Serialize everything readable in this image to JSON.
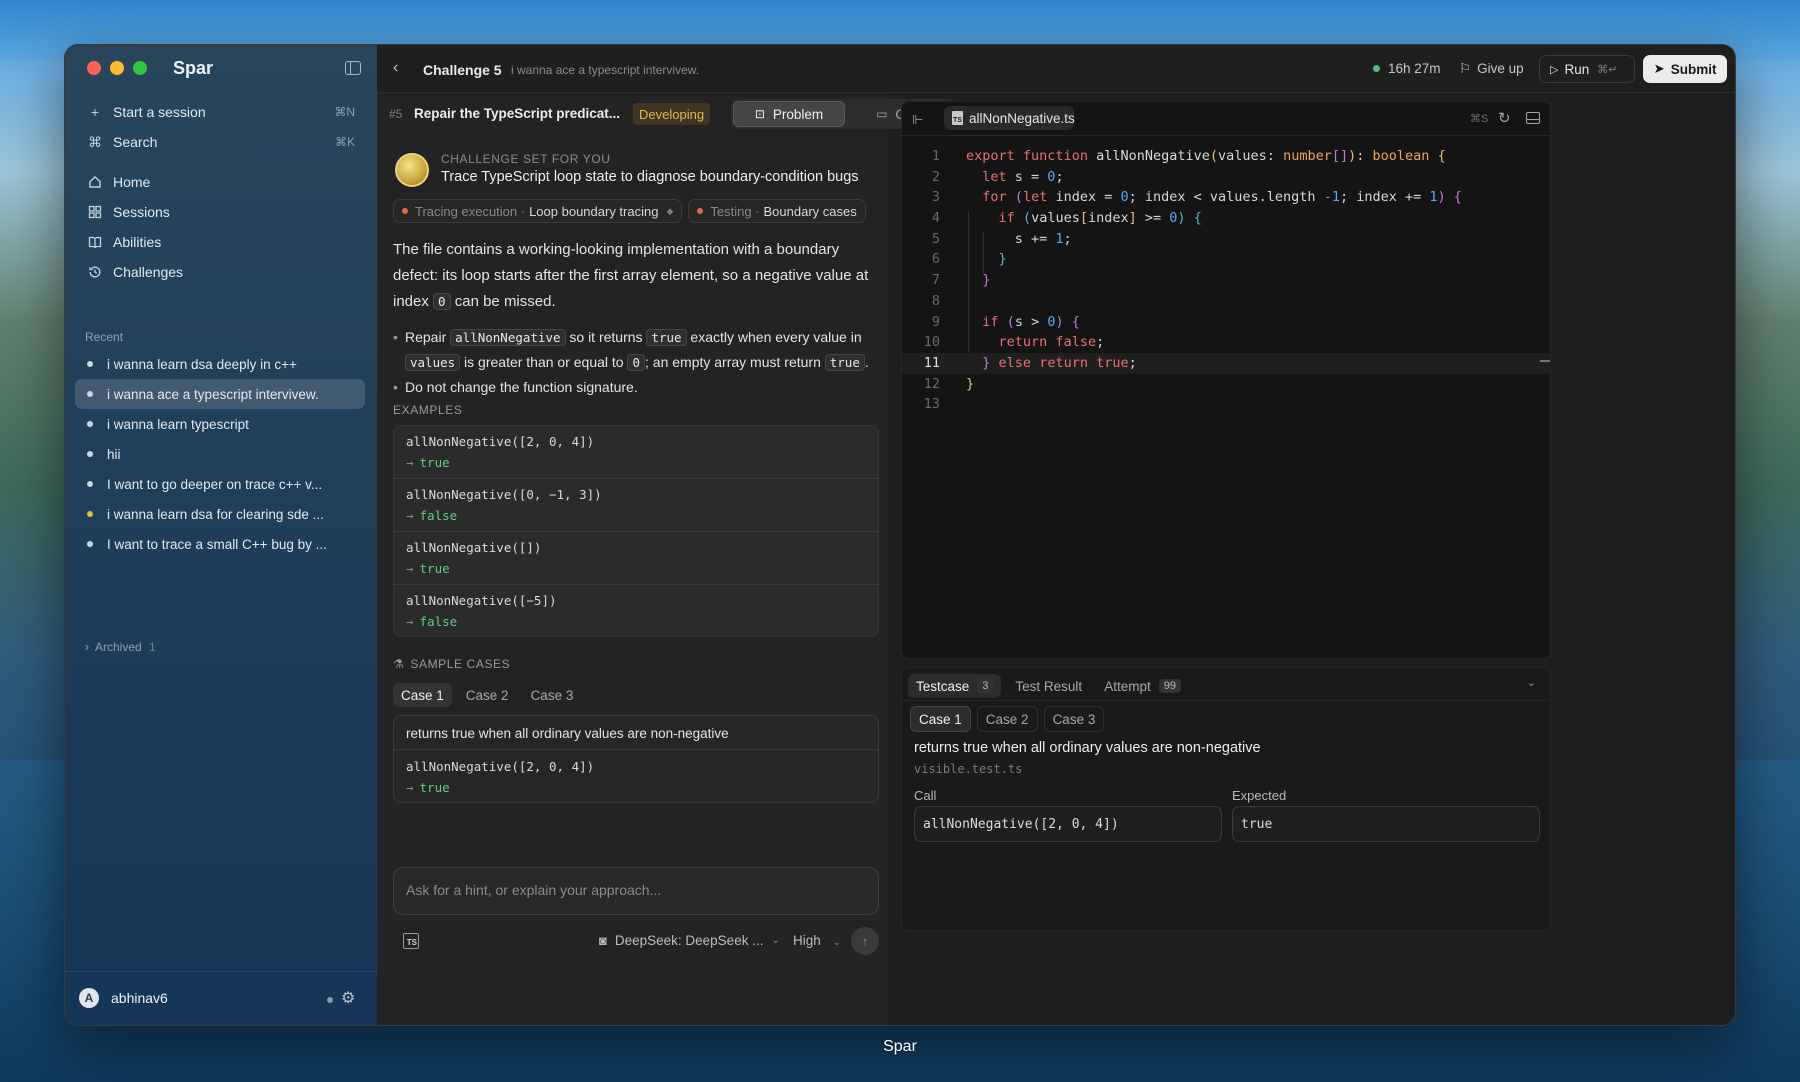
{
  "app": {
    "name": "Spar"
  },
  "sidebar": {
    "nav_top": [
      {
        "label": "Start a session",
        "shortcut": "⌘N",
        "icon": "plus-icon"
      },
      {
        "label": "Search",
        "shortcut": "⌘K",
        "icon": "command-icon"
      }
    ],
    "nav": [
      {
        "label": "Home",
        "icon": "home-icon"
      },
      {
        "label": "Sessions",
        "icon": "grid-icon"
      },
      {
        "label": "Abilities",
        "icon": "book-icon"
      },
      {
        "label": "Challenges",
        "icon": "history-icon"
      }
    ],
    "recent_label": "Recent",
    "recent": [
      {
        "label": "i wanna learn dsa deeply in c++",
        "dot": "#cfd8df"
      },
      {
        "label": "i wanna ace a typescript intervivew.",
        "dot": "#cfd8df",
        "active": true
      },
      {
        "label": "i wanna learn typescript",
        "dot": "#cfd8df"
      },
      {
        "label": "hii",
        "dot": "#cfd8df"
      },
      {
        "label": "I want to go deeper on trace c++ v...",
        "dot": "#cfd8df"
      },
      {
        "label": "i wanna learn dsa for clearing sde ...",
        "dot": "#e8b84a"
      },
      {
        "label": "I want to trace a small C++ bug by ...",
        "dot": "#cfd8df"
      }
    ],
    "archived": {
      "label": "Archived",
      "count": "1"
    },
    "user": {
      "initial": "A",
      "name": "abhinav6"
    }
  },
  "topbar": {
    "title": "Challenge 5",
    "subtitle": "i wanna ace a typescript intervivew.",
    "timer": "16h 27m",
    "give_up": "Give up",
    "run": "Run",
    "run_kbd": "⌘↵",
    "submit": "Submit"
  },
  "problem": {
    "number": "#5",
    "title": "Repair the TypeScript predicat...",
    "status": "Developing",
    "tabs": [
      "Problem",
      "Chat"
    ],
    "kicker": "CHALLENGE SET FOR YOU",
    "challenge_title": "Trace TypeScript loop state to diagnose boundary-condition bugs",
    "chips": [
      {
        "category": "Tracing execution ·",
        "label": "Loop boundary tracing"
      },
      {
        "category": "Testing ·",
        "label": "Boundary cases"
      }
    ],
    "description_a": "The file contains a working-looking implementation with a boundary defect: its loop starts after the first array element, so a negative value at index",
    "description_code": "0",
    "description_b": "can be missed.",
    "bullet1": {
      "a": "Repair",
      "c1": "allNonNegative",
      "b": "so it returns",
      "c2": "true",
      "c": "exactly when every value in",
      "c3": "values",
      "d": "is greater than or equal to",
      "c4": "0",
      "e": "; an empty array must return",
      "c5": "true",
      "f": "."
    },
    "bullet2": "Do not change the function signature.",
    "examples_label": "EXAMPLES",
    "examples": [
      {
        "call": "allNonNegative([2, 0, 4])",
        "result": "true"
      },
      {
        "call": "allNonNegative([0, −1, 3])",
        "result": "false"
      },
      {
        "call": "allNonNegative([])",
        "result": "true"
      },
      {
        "call": "allNonNegative([−5])",
        "result": "false"
      }
    ],
    "sample_label": "SAMPLE CASES",
    "case_tabs": [
      "Case 1",
      "Case 2",
      "Case 3"
    ],
    "sample_case": {
      "name": "returns true when all ordinary values are non-negative",
      "call": "allNonNegative([2, 0, 4])",
      "result": "true"
    },
    "prompt_placeholder": "Ask for a hint, or explain your approach...",
    "model": "DeepSeek: DeepSeek ...",
    "level": "High"
  },
  "editor": {
    "filename": "allNonNegative.ts",
    "save_kbd": "⌘S",
    "current_line": 11,
    "line_numbers": [
      "1",
      "2",
      "3",
      "4",
      "5",
      "6",
      "7",
      "8",
      "9",
      "10",
      "11",
      "12",
      "13"
    ]
  },
  "tests": {
    "tabs": [
      {
        "label": "Testcase",
        "count": "3"
      },
      {
        "label": "Test Result",
        "count": ""
      },
      {
        "label": "Attempt",
        "count": "99"
      }
    ],
    "case_tabs": [
      "Case 1",
      "Case 2",
      "Case 3"
    ],
    "name": "returns true when all ordinary values are non-negative",
    "file": "visible.test.ts",
    "call_label": "Call",
    "call": "allNonNegative([2, 0, 4])",
    "expected_label": "Expected",
    "expected": "true"
  },
  "dock_label": "Spar",
  "colors": {
    "accent_green": "#5ccf86",
    "status_amber": "#e6b84c",
    "timer_dot": "#4ac07a"
  }
}
